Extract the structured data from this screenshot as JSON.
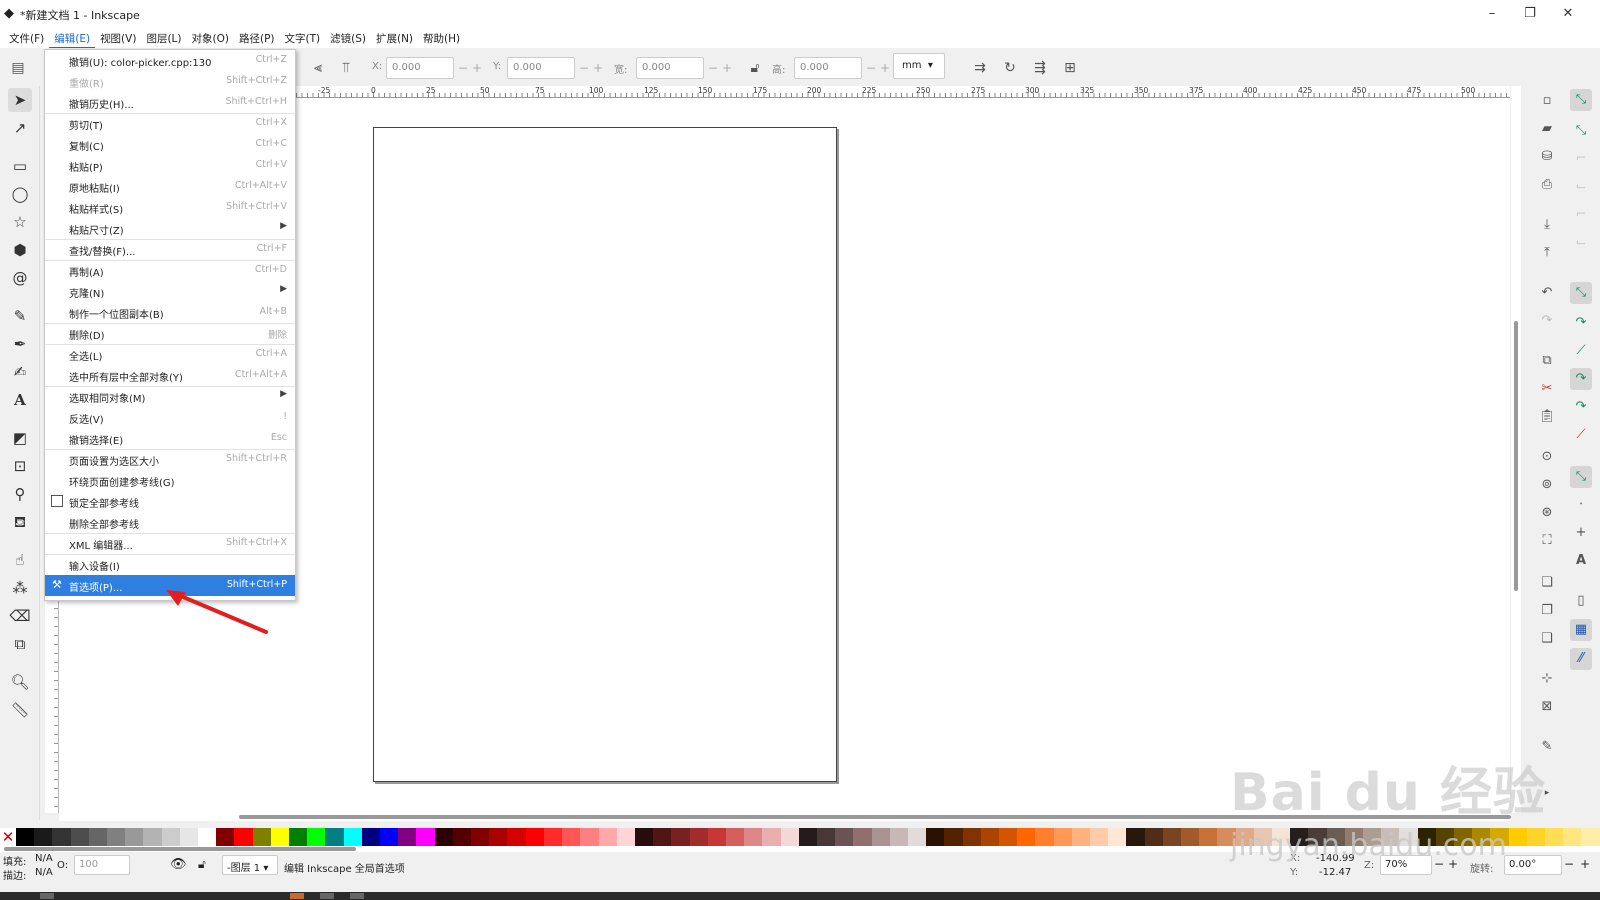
{
  "window": {
    "title": "*新建文档 1 - Inkscape",
    "minimize": "–",
    "restore": "❐",
    "close": "✕"
  },
  "menubar": [
    "文件(F)",
    "编辑(E)",
    "视图(V)",
    "图层(L)",
    "对象(O)",
    "路径(P)",
    "文字(T)",
    "滤镜(S)",
    "扩展(N)",
    "帮助(H)"
  ],
  "controls": {
    "x_label": "X:",
    "x_value": "0.000",
    "y_label": "Y:",
    "y_value": "0.000",
    "w_label": "宽:",
    "w_value": "0.000",
    "h_label": "高:",
    "h_value": "0.000",
    "unit": "mm",
    "minus": "−",
    "plus": "+"
  },
  "ruler": {
    "labels": [
      "-25",
      "0",
      "25",
      "50",
      "75",
      "100",
      "125",
      "150",
      "175",
      "200",
      "225",
      "250",
      "275",
      "300",
      "325",
      "350",
      "375",
      "400",
      "425",
      "450",
      "475",
      "500"
    ]
  },
  "edit_menu": [
    {
      "label": "撤销(U): color-picker.cpp:130",
      "shortcut": "Ctrl+Z"
    },
    {
      "label": "重做(R)",
      "shortcut": "Shift+Ctrl+Z",
      "disabled": true
    },
    {
      "label": "撤销历史(H)...",
      "shortcut": "Shift+Ctrl+H"
    },
    {
      "label": "剪切(T)",
      "shortcut": "Ctrl+X"
    },
    {
      "label": "复制(C)",
      "shortcut": "Ctrl+C"
    },
    {
      "label": "粘贴(P)",
      "shortcut": "Ctrl+V"
    },
    {
      "label": "原地粘贴(I)",
      "shortcut": "Ctrl+Alt+V"
    },
    {
      "label": "粘贴样式(S)",
      "shortcut": "Shift+Ctrl+V"
    },
    {
      "label": "粘贴尺寸(Z)",
      "shortcut": "",
      "submenu": true
    },
    {
      "label": "查找/替换(F)...",
      "shortcut": "Ctrl+F"
    },
    {
      "label": "再制(A)",
      "shortcut": "Ctrl+D"
    },
    {
      "label": "克隆(N)",
      "shortcut": "",
      "submenu": true
    },
    {
      "label": "制作一个位图副本(B)",
      "shortcut": "Alt+B"
    },
    {
      "label": "删除(D)",
      "shortcut": "删除"
    },
    {
      "label": "全选(L)",
      "shortcut": "Ctrl+A"
    },
    {
      "label": "选中所有层中全部对象(Y)",
      "shortcut": "Ctrl+Alt+A"
    },
    {
      "label": "选取相同对象(M)",
      "shortcut": "",
      "submenu": true
    },
    {
      "label": "反选(V)",
      "shortcut": "!"
    },
    {
      "label": "撤销选择(E)",
      "shortcut": "Esc"
    },
    {
      "label": "页面设置为选区大小",
      "shortcut": "Shift+Ctrl+R"
    },
    {
      "label": "环绕页面创建参考线(G)",
      "shortcut": ""
    },
    {
      "label": "锁定全部参考线",
      "shortcut": "",
      "checkbox": true
    },
    {
      "label": "删除全部参考线",
      "shortcut": ""
    },
    {
      "label": "XML 编辑器...",
      "shortcut": "Shift+Ctrl+X"
    },
    {
      "label": "输入设备(I)",
      "shortcut": ""
    },
    {
      "label": "首选项(P)...",
      "shortcut": "Shift+Ctrl+P",
      "highlighted": true
    }
  ],
  "status": {
    "fill_label": "填充:",
    "fill_value": "N/A",
    "stroke_label": "描边:",
    "stroke_value": "N/A",
    "opacity_label": "O:",
    "opacity_value": "100",
    "layer": "-图层 1",
    "message": "编辑 Inkscape 全局首选项",
    "x_label": "X:",
    "x_value": "-140.99",
    "y_label": "Y:",
    "y_value": "-12.47",
    "zoom_label": "Z:",
    "zoom_value": "70%",
    "rotate_label": "旋转:",
    "rotate_value": "0.00°"
  },
  "watermark": {
    "line1": "Bai du 经验",
    "line2": "jingyan.baidu.com"
  },
  "palette": [
    "#000000",
    "#1a1a1a",
    "#333333",
    "#4d4d4d",
    "#666666",
    "#808080",
    "#999999",
    "#b3b3b3",
    "#cccccc",
    "#e6e6e6",
    "#ffffff",
    "#800000",
    "#ff0000",
    "#808000",
    "#ffff00",
    "#008000",
    "#00ff00",
    "#008080",
    "#00ffff",
    "#000080",
    "#0000ff",
    "#800080",
    "#ff00ff",
    "#2b0000",
    "#550000",
    "#800000",
    "#aa0000",
    "#d40000",
    "#ff0000",
    "#ff2a2a",
    "#ff5555",
    "#ff8080",
    "#ffaaaa",
    "#ffd5d5",
    "#280b0b",
    "#501616",
    "#782121",
    "#a02c2c",
    "#c83737",
    "#d35f5f",
    "#de8787",
    "#e9afaf",
    "#f4d7d7",
    "#241c1c",
    "#483737",
    "#6c5353",
    "#916f6f",
    "#ac9393",
    "#c8b7b7",
    "#e3dbdb",
    "#2b1100",
    "#552200",
    "#803300",
    "#aa4400",
    "#d45500",
    "#ff6600",
    "#ff7f2a",
    "#ff9955",
    "#ffb380",
    "#ffccaa",
    "#ffe6d5",
    "#28170b",
    "#502d16",
    "#784421",
    "#a05a2c",
    "#c87137",
    "#d38d5f",
    "#deaa87",
    "#e9c6af",
    "#f4e3d7",
    "#241f1c",
    "#483e37",
    "#6c5d53",
    "#917c6f",
    "#ac9d93",
    "#c8beb7",
    "#e3dedb",
    "#2b2200",
    "#554400",
    "#806600",
    "#aa8800",
    "#d4aa00",
    "#ffcc00",
    "#ffd42a",
    "#ffdd55",
    "#ffe680",
    "#ffeeaa"
  ],
  "colors": {
    "accent": "#2f7fe0",
    "arrow": "#e02020"
  }
}
